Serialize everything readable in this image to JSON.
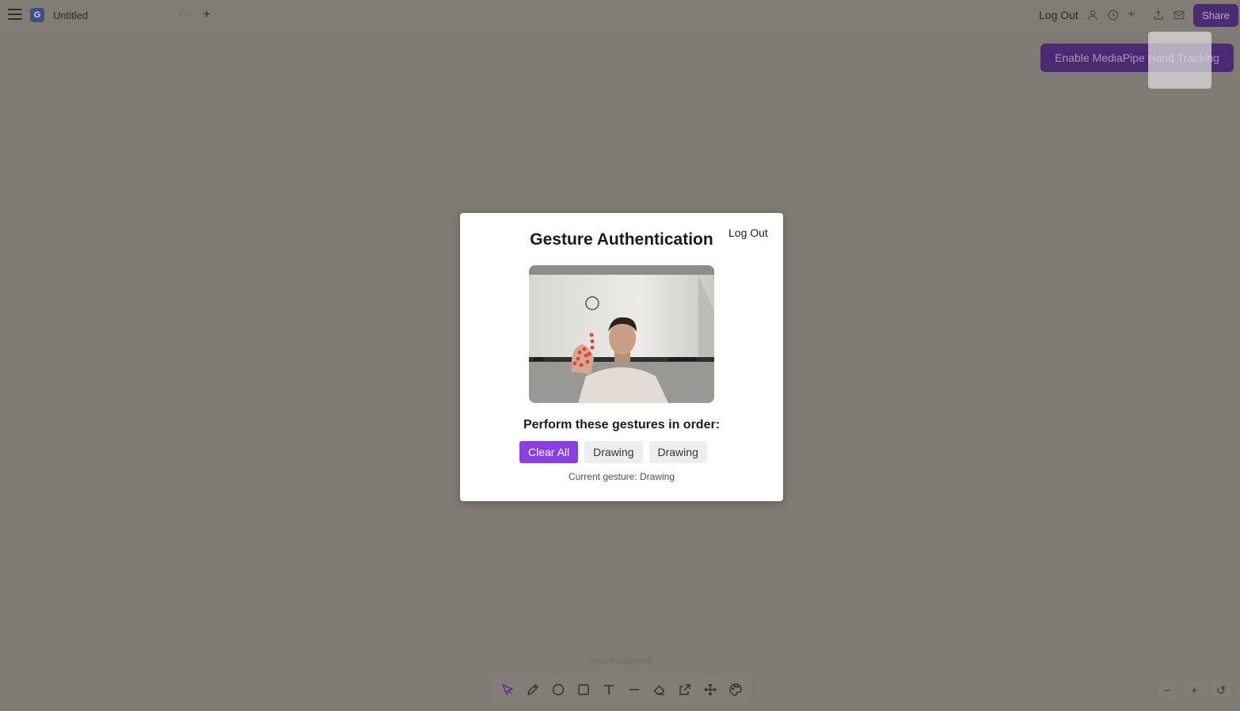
{
  "header": {
    "doc_title": "Untitled",
    "file_tab": "File",
    "logout_label": "Log Out",
    "share_label": "Share",
    "app_logo_letter": "G"
  },
  "mediapipe": {
    "button_label": "Enable MediaPipe Hand Tracking"
  },
  "status": {
    "text": "Hand Tracking Off"
  },
  "toolbar": {
    "tools": [
      "select-icon",
      "pencil-icon",
      "circle-icon",
      "rectangle-icon",
      "text-icon",
      "line-icon",
      "eraser-icon",
      "export-icon",
      "move-icon",
      "palette-icon"
    ]
  },
  "zoom": {
    "out_label": "−",
    "in_label": "+",
    "reset_label": "↺"
  },
  "modal": {
    "title": "Gesture Authentication",
    "logout_label": "Log Out",
    "instruction": "Perform these gestures in order:",
    "gestures": [
      "Clear All",
      "Drawing",
      "Drawing"
    ],
    "current_gesture": "Current gesture: Drawing"
  },
  "colors": {
    "accent": "#8a3fe0",
    "overlay_dim": "#7d7b73"
  }
}
